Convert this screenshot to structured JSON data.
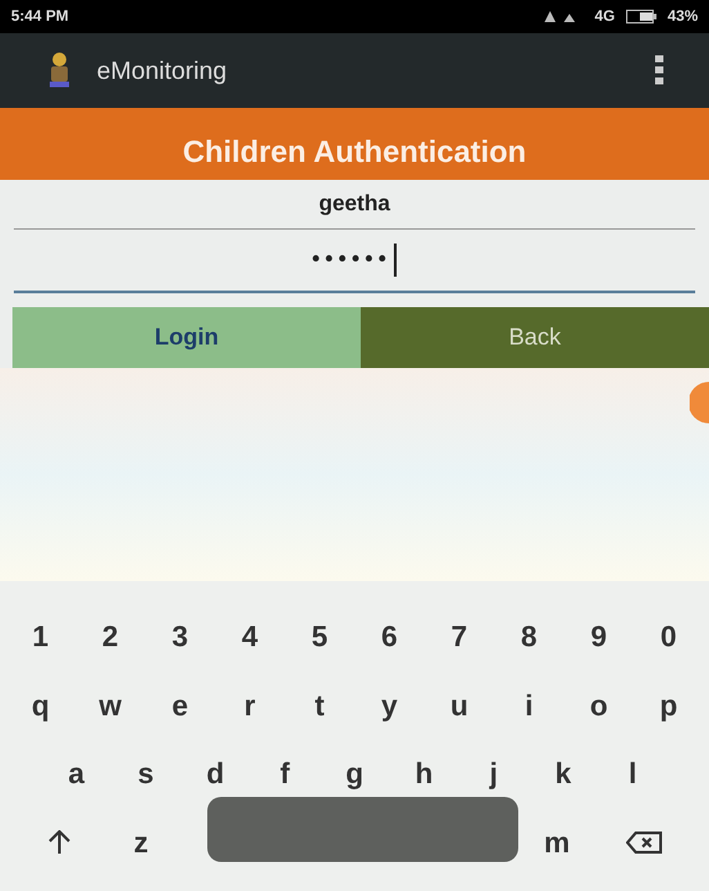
{
  "status_bar": {
    "time": "5:44 PM",
    "network": "4G",
    "battery": "43%"
  },
  "app_bar": {
    "title": "eMonitoring"
  },
  "header": {
    "title": "Children Authentication"
  },
  "fields": [
    {
      "kind": "text",
      "value": "geetha",
      "focused": false
    },
    {
      "kind": "password",
      "value": "••••••",
      "focused": true
    }
  ],
  "buttons": [
    {
      "label": "Login",
      "kind": "primary"
    },
    {
      "label": "Back",
      "kind": "secondary"
    }
  ],
  "keyboard": {
    "rows": [
      [
        "1",
        "2",
        "3",
        "4",
        "5",
        "6",
        "7",
        "8",
        "9",
        "0"
      ],
      [
        "q",
        "w",
        "e",
        "r",
        "t",
        "y",
        "u",
        "i",
        "o",
        "p"
      ],
      [
        "a",
        "s",
        "d",
        "f",
        "g",
        "h",
        "j",
        "k",
        "l"
      ]
    ],
    "bottom_row": [
      {
        "kind": "shift"
      },
      {
        "kind": "key",
        "label": "z"
      },
      {
        "kind": "gap"
      },
      {
        "kind": "key",
        "label": "m"
      },
      {
        "kind": "backspace"
      }
    ]
  },
  "toast": {
    "kind": "toast"
  }
}
